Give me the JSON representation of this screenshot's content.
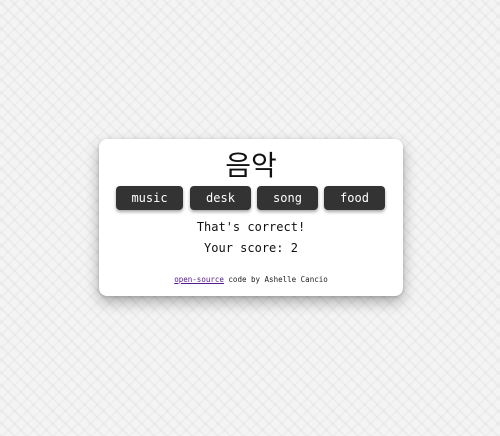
{
  "quiz": {
    "word": "음악",
    "options": [
      "music",
      "desk",
      "song",
      "food"
    ],
    "feedback": "That's correct!",
    "score_label": "Your score:",
    "score_value": "2"
  },
  "footer": {
    "link_text": "open-source",
    "rest_text": " code by Ashelle Cancio"
  }
}
